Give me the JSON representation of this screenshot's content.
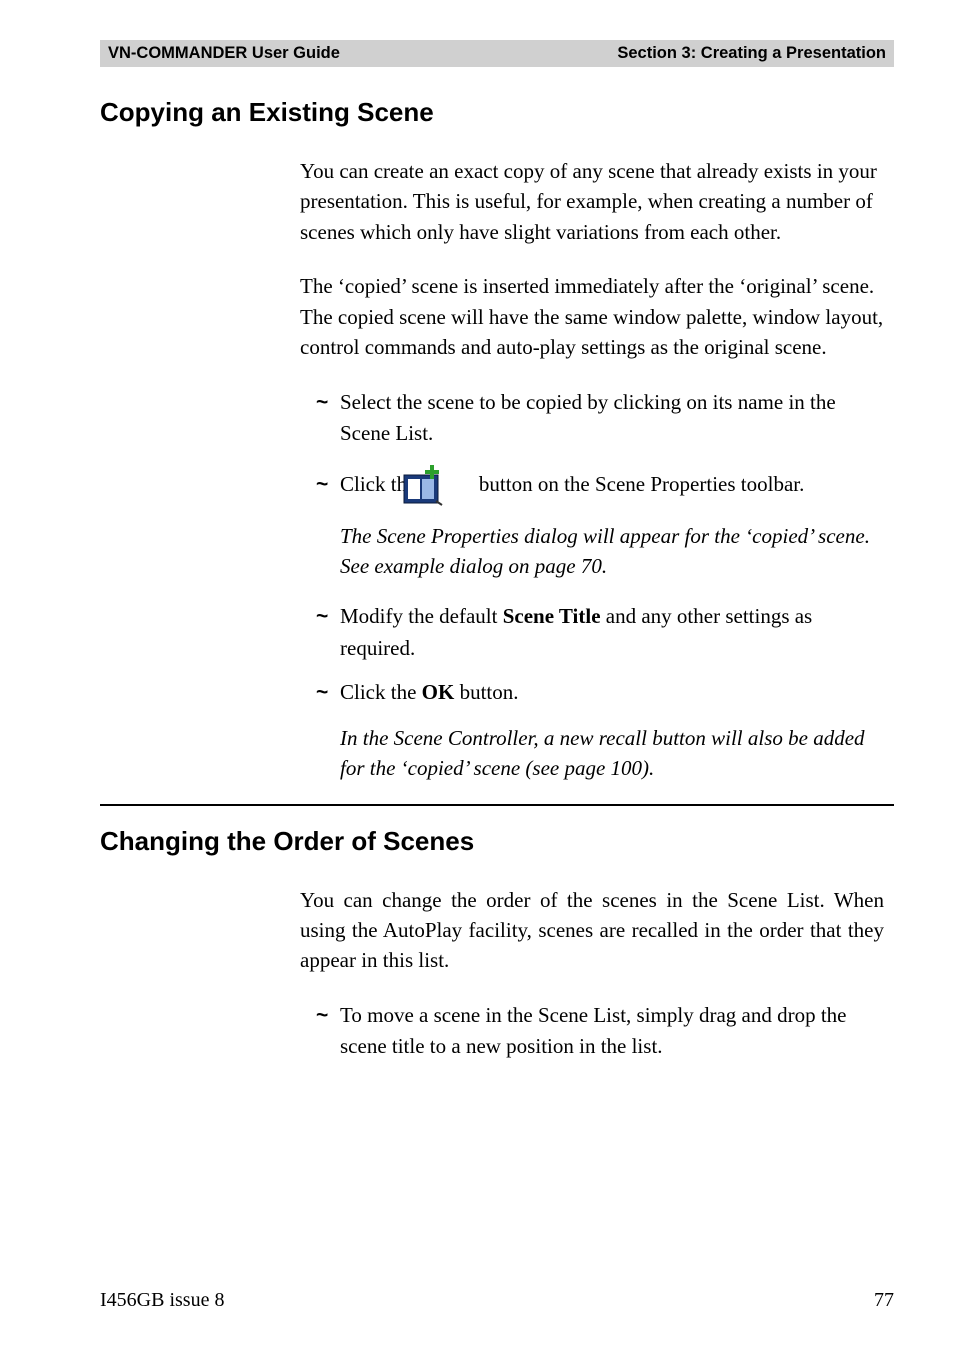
{
  "header": {
    "left": "VN-COMMANDER User Guide",
    "right": "Section 3: Creating a Presentation"
  },
  "section1": {
    "title": "Copying an Existing Scene",
    "para1": "You can create an exact copy of any scene that already exists in your presentation. This is useful, for example, when creating a number of scenes which only have slight variations from each other.",
    "para2": "The ‘copied’ scene is inserted immediately after the ‘original’ scene. The copied scene will have the same window palette, window layout, control commands and auto-play settings as the original scene.",
    "step1": "Select the scene to be copied by clicking on its name in the Scene List.",
    "step2_a": "Click the",
    "step2_b": "button on the Scene Properties toolbar.",
    "step2_note": "The Scene Properties dialog will appear for the ‘copied’ scene. See example dialog on page 70.",
    "step3_a": "Modify the default ",
    "step3_bold": "Scene Title",
    "step3_b": " and any other settings as required.",
    "step4_a": "Click the ",
    "step4_bold": "OK",
    "step4_b": " button.",
    "step4_note": "In the Scene Controller, a new recall button will also be added for the ‘copied’ scene (see page 100)."
  },
  "section2": {
    "title": "Changing the Order of Scenes",
    "para1": "You can change the order of the scenes in the Scene List. When using the AutoPlay facility, scenes are recalled in the order that they appear in this list.",
    "step1": "To move a scene in the Scene List, simply drag and drop the scene title to a new position in the list."
  },
  "footer": {
    "left": "I456GB issue 8",
    "right": "77"
  },
  "tilde": "~"
}
